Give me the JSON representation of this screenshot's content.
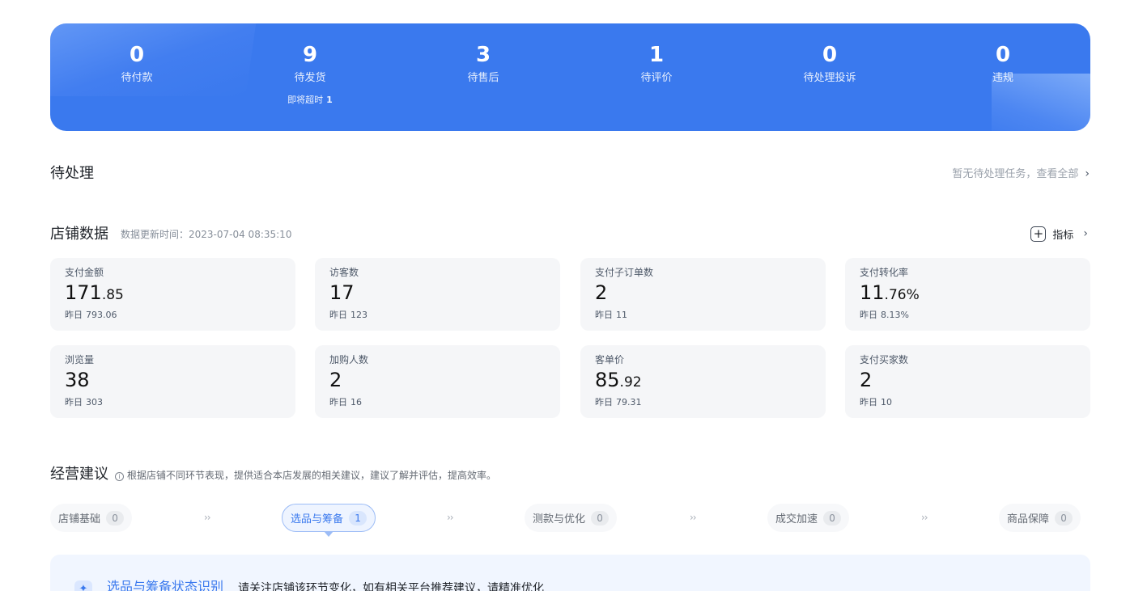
{
  "banner": {
    "accent": "#3a79ee",
    "items": [
      {
        "count": "0",
        "label": "待付款"
      },
      {
        "count": "9",
        "label": "待发货",
        "sub_label": "即将超时",
        "sub_value": "1"
      },
      {
        "count": "3",
        "label": "待售后"
      },
      {
        "count": "1",
        "label": "待评价"
      },
      {
        "count": "0",
        "label": "待处理投诉"
      },
      {
        "count": "0",
        "label": "违规"
      }
    ]
  },
  "pending": {
    "title": "待处理",
    "link_text": "暂无待处理任务，查看全部",
    "chevron": "›"
  },
  "shop_data": {
    "title": "店铺数据",
    "updated": "数据更新时间：2023-07-04 08:35:10",
    "metrics_button": "指标",
    "plus": "+",
    "chevron": "›",
    "cards": [
      {
        "label": "支付金额",
        "int": "171",
        "dec": ".85",
        "yest_label": "昨日",
        "yest": "793.06"
      },
      {
        "label": "访客数",
        "int": "17",
        "dec": "",
        "yest_label": "昨日",
        "yest": "123"
      },
      {
        "label": "支付子订单数",
        "int": "2",
        "dec": "",
        "yest_label": "昨日",
        "yest": "11"
      },
      {
        "label": "支付转化率",
        "int": "11",
        "dec": ".76%",
        "yest_label": "昨日",
        "yest": "8.13%"
      },
      {
        "label": "浏览量",
        "int": "38",
        "dec": "",
        "yest_label": "昨日",
        "yest": "303"
      },
      {
        "label": "加购人数",
        "int": "2",
        "dec": "",
        "yest_label": "昨日",
        "yest": "16"
      },
      {
        "label": "客单价",
        "int": "85",
        "dec": ".92",
        "yest_label": "昨日",
        "yest": "79.31"
      },
      {
        "label": "支付买家数",
        "int": "2",
        "dec": "",
        "yest_label": "昨日",
        "yest": "10"
      }
    ]
  },
  "advice": {
    "title": "经营建议",
    "info_glyph": "i",
    "note": "根据店铺不同环节表现，提供适合本店发展的相关建议，建议了解并评估，提高效率。",
    "separator": "››",
    "stages": [
      {
        "label": "店铺基础",
        "count": "0"
      },
      {
        "label": "选品与筹备",
        "count": "1",
        "active": true
      },
      {
        "label": "测款与优化",
        "count": "0"
      },
      {
        "label": "成交加速",
        "count": "0"
      },
      {
        "label": "商品保障",
        "count": "0"
      }
    ],
    "panel": {
      "icon": "sparkle-icon",
      "title": "选品与筹备状态识别",
      "desc": "请关注店铺该环节变化，如有相关平台推荐建议，请精准优化"
    }
  }
}
